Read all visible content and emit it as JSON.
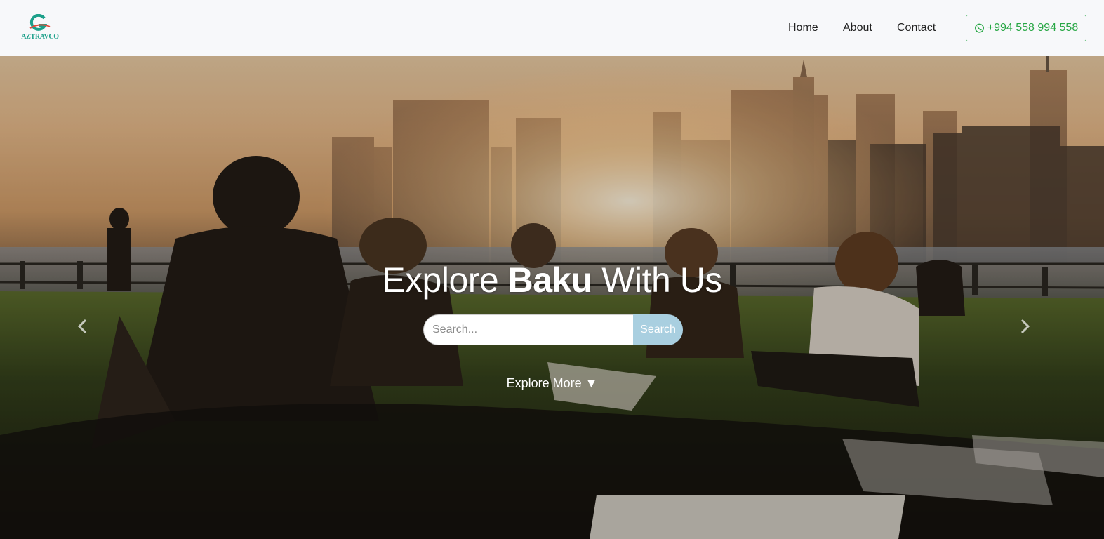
{
  "brand": {
    "logo_text": "AZTRAVCO"
  },
  "nav": {
    "links": [
      "Home",
      "About",
      "Contact"
    ],
    "phone": "+994 558 994 558"
  },
  "hero": {
    "title_start": "Explore",
    "title_bold": "Baku",
    "title_end": "With Us",
    "search_placeholder": "Search...",
    "search_button": "Search",
    "explore_more": "Explore More ▼"
  },
  "icons": {
    "phone": "whatsapp-icon",
    "prev": "chevron-left-icon",
    "next": "chevron-right-icon"
  },
  "colors": {
    "brand_teal": "#1ca08a",
    "phone_green": "#28a745",
    "search_button": "#a9cfe0",
    "navbar_bg": "#f7f8fa"
  }
}
